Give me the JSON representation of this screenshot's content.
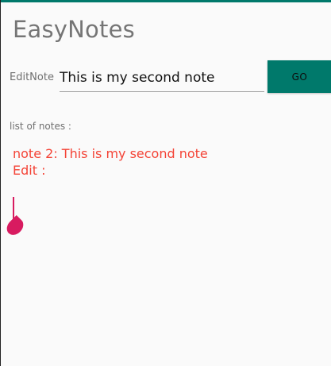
{
  "app": {
    "title": "EasyNotes"
  },
  "editor": {
    "label": "EditNote",
    "value": "This is my second note",
    "go_label": "GO"
  },
  "list": {
    "label": "list of notes :",
    "items": [
      {
        "title": "note 2:  This is my second note",
        "edit_label": "Edit :"
      }
    ]
  },
  "colors": {
    "accent": "#00796b",
    "note_text": "#f44336",
    "handle": "#d81b60"
  },
  "icons": {
    "scroll_handle": "teardrop-handle-icon"
  }
}
